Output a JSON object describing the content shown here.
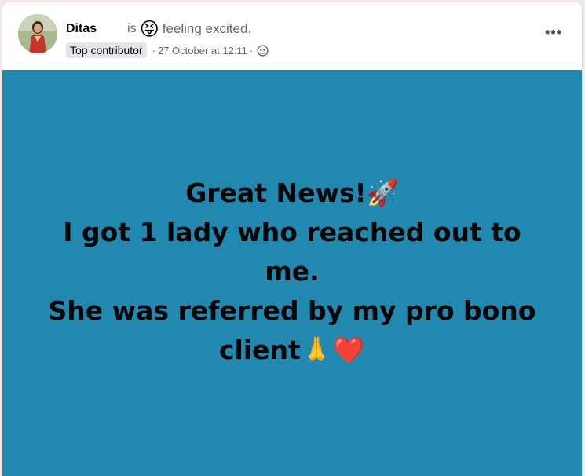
{
  "post": {
    "author": "Ditas",
    "is_word": "is",
    "feeling_emoji": "😝",
    "feeling_text": "feeling excited.",
    "badge": "Top contributor",
    "separator": "·",
    "timestamp": "27 October at 12:11",
    "audience_icon": "public-globe-icon",
    "more_icon": "more-options-icon",
    "background_color": "#2188b0",
    "lines": [
      {
        "text": "Great News!",
        "emoji": "🚀"
      },
      {
        "text": "I got 1 lady who reached out to me.",
        "emoji": ""
      },
      {
        "text": "She was referred by my pro bono",
        "emoji": ""
      },
      {
        "text": "client",
        "emoji": "🙏❤️"
      }
    ]
  }
}
